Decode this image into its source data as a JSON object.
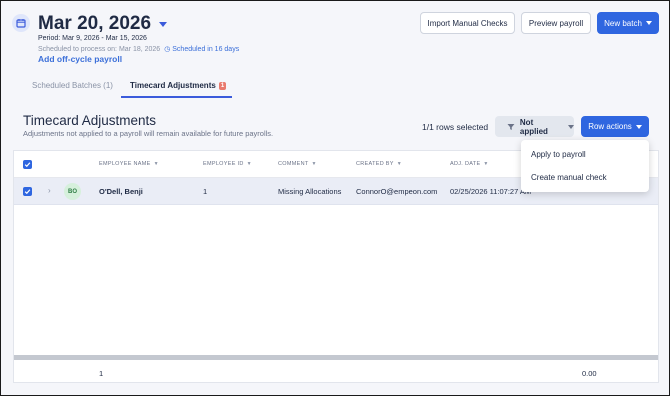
{
  "header": {
    "date_title": "Mar 20, 2026",
    "period": "Period: Mar 9, 2026 - Mar 15, 2026",
    "scheduled_label": "Scheduled to process on: Mar 18, 2026",
    "scheduled_in": "Scheduled in 16 days",
    "offcycle_link": "Add off-cycle payroll"
  },
  "toolbar": {
    "import_label": "Import Manual Checks",
    "preview_label": "Preview payroll",
    "new_batch_label": "New batch"
  },
  "tabs": [
    {
      "label": "Scheduled Batches (1)",
      "active": false
    },
    {
      "label": "Timecard Adjustments",
      "badge": "1",
      "active": true
    }
  ],
  "section": {
    "title": "Timecard Adjustments",
    "subtitle": "Adjustments not applied to a payroll will remain available for future payrolls.",
    "rows_selected": "1/1 rows selected",
    "filter_label": "Not applied",
    "row_actions_label": "Row actions"
  },
  "table": {
    "columns": [
      "EMPLOYEE NAME",
      "EMPLOYEE ID",
      "COMMENT",
      "CREATED BY",
      "ADJ. DATE"
    ],
    "rows": [
      {
        "initials": "BO",
        "employee_name": "O'Dell, Benji",
        "employee_id": "1",
        "comment": "Missing Allocations",
        "created_by": "ConnorO@empeon.com",
        "adj_date": "02/25/2026 11:07:27 AM"
      }
    ],
    "footer": {
      "count": "1",
      "total": "0.00"
    }
  },
  "menu": {
    "items": [
      "Apply to payroll",
      "Create manual check"
    ]
  },
  "colors": {
    "primary": "#2f66e0",
    "link": "#3b6fd9",
    "badge": "#e97a6e"
  }
}
